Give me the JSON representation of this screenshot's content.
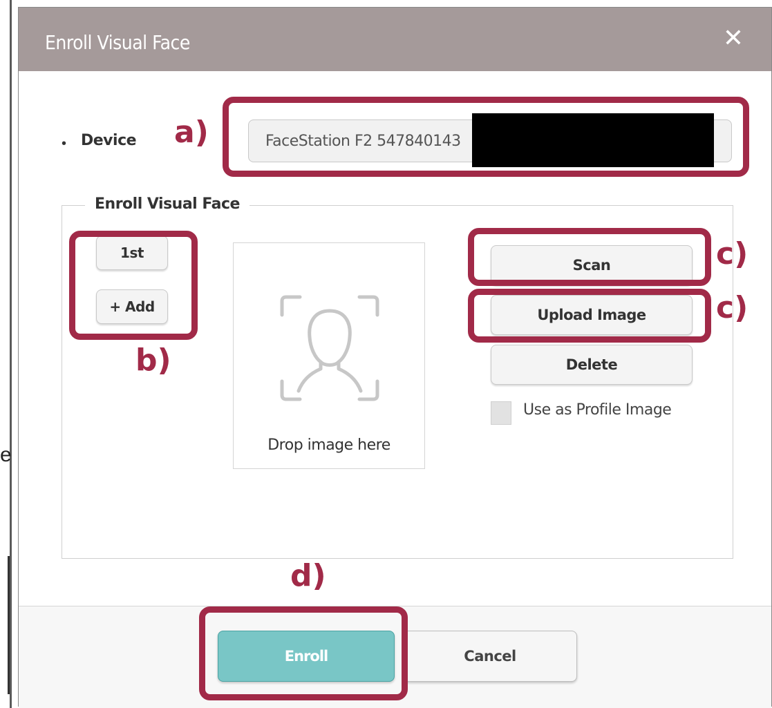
{
  "background": {
    "stray_text": "e"
  },
  "dialog": {
    "title": "Enroll Visual Face",
    "close_symbol": "✕",
    "titlebar_color": "#a59a9a"
  },
  "device": {
    "bullet": "•",
    "label": "Device",
    "value": "FaceStation F2 547840143"
  },
  "enroll_section": {
    "legend": "Enroll Visual Face",
    "slots": [
      "1st",
      "+ Add"
    ],
    "dropzone_text": "Drop image here",
    "dropzone_icon": "face-scan-icon",
    "actions": {
      "scan": "Scan",
      "upload": "Upload Image",
      "delete": "Delete"
    },
    "profile_checkbox": {
      "label": "Use as Profile Image",
      "checked": false
    }
  },
  "footer": {
    "enroll": "Enroll",
    "cancel": "Cancel",
    "enroll_color": "#79c6c6"
  },
  "annotations": {
    "color": "#a12a48",
    "a": "a)",
    "b": "b)",
    "c1": "c)",
    "c2": "c)",
    "d": "d)"
  }
}
